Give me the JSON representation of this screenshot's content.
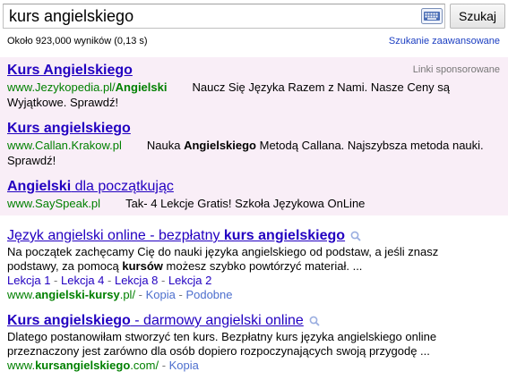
{
  "search": {
    "query": "kurs angielskiego",
    "button_label": "Szukaj",
    "stats": "Około 923,000 wyników (0,13 s)",
    "advanced": "Szukanie zaawansowane"
  },
  "ads": {
    "label": "Linki sponsorowane",
    "items": [
      {
        "title": "Kurs Angielskiego",
        "url_pre": "www.Jezykopedia.pl/",
        "url_bold": "Angielski",
        "text": "Naucz Się Języka Razem z Nami. Nasze Ceny są",
        "text2": "Wyjątkowe. Sprawdź!"
      },
      {
        "title": "Kurs angielskiego",
        "url": "www.Callan.Krakow.pl",
        "text_pre": "Nauka ",
        "text_bold": "Angielskiego",
        "text_post": " Metodą Callana. Najszybsza metoda nauki.",
        "text2": "Sprawdź!"
      },
      {
        "title_bold": "Angielski",
        "title_rest": " dla początkując",
        "url": "www.SaySpeak.pl",
        "text": "Tak- 4 Lekcje Gratis! Szkoła Językowa OnLine"
      }
    ]
  },
  "results": [
    {
      "title_pre": "Język angielski online - bezpłatny ",
      "title_bold": "kurs angielskiego",
      "snippet1": "Na początek zachęcamy Cię do nauki języka angielskiego od podstaw, a jeśli znasz",
      "snippet2_pre": "podstawy, za pomocą ",
      "snippet2_bold": "kursów",
      "snippet2_post": " możesz szybko powtórzyć materiał. ...",
      "sitelinks": [
        "Lekcja 1",
        "Lekcja 4",
        "Lekcja 8",
        "Lekcja 2"
      ],
      "url_pre": "www.",
      "url_bold": "angielski-kursy",
      "url_post": ".pl/",
      "cache": "Kopia",
      "similar": "Podobne"
    },
    {
      "title_bold": "Kurs angielskiego",
      "title_post": " - darmowy angielski online",
      "snippet1": "Dlatego postanowiłam stworzyć ten kurs. Bezpłatny kurs języka angielskiego online",
      "snippet2": "przeznaczony jest zarówno dla osób dopiero rozpoczynających swoją przygodę ...",
      "url_pre": "www.",
      "url_bold": "kursangielskiego",
      "url_post": ".com/",
      "cache": "Kopia"
    }
  ]
}
